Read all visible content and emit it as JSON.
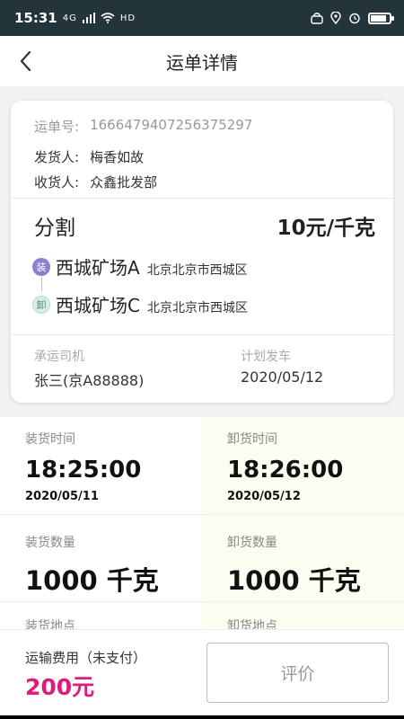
{
  "status_bar": {
    "time": "15:31",
    "signal_text": "4G",
    "network_text": "HD",
    "battery_level": 0.85
  },
  "nav": {
    "title": "运单详情"
  },
  "order": {
    "number_label": "运单号:",
    "number_value": "1666479407256375297",
    "shipper_label": "发货人:",
    "shipper_value": "梅香如故",
    "receiver_label": "收货人:",
    "receiver_value": "众鑫批发部",
    "goods": "分割",
    "price": "10元/千克",
    "load_badge": "装",
    "load_name": "西城矿场A",
    "load_address": "北京北京市西城区",
    "unload_badge": "卸",
    "unload_name": "西城矿场C",
    "unload_address": "北京北京市西城区",
    "driver_label": "承运司机",
    "driver_value": "张三(京A88888)",
    "depart_label": "计划发车",
    "depart_value": "2020/05/12"
  },
  "details": {
    "load_time_label": "装货时间",
    "load_time": "18:25:00",
    "load_date": "2020/05/11",
    "unload_time_label": "卸货时间",
    "unload_time": "18:26:00",
    "unload_date": "2020/05/12",
    "load_qty_label": "装货数量",
    "load_qty": "1000 千克",
    "unload_qty_label": "卸货数量",
    "unload_qty": "1000 千克",
    "load_place_label": "装货地点",
    "unload_place_label": "卸货地点"
  },
  "footer": {
    "fee_label": "运输费用（未支付）",
    "fee_value": "200元",
    "rate_button": "评价"
  }
}
